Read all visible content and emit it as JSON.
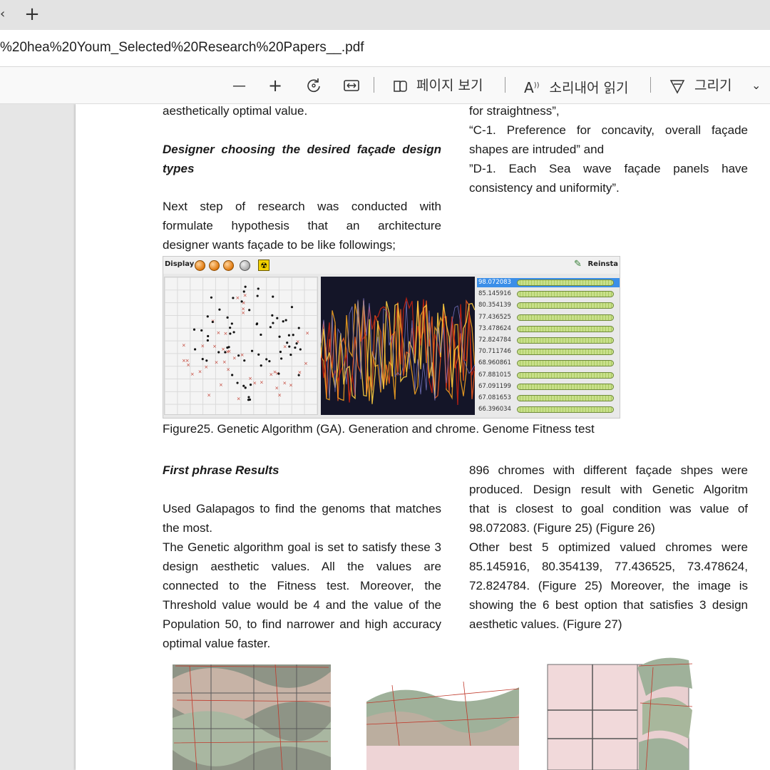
{
  "browser": {
    "close_glyph": "‹",
    "new_tab_glyph": "+",
    "url": "%20hea%20Youm_Selected%20Research%20Papers__.pdf"
  },
  "toolbar": {
    "zoom_out": "—",
    "zoom_in": "+",
    "rotate_icon": "rotate-icon",
    "fit_icon": "fit-width-icon",
    "page_view_label": "페이지 보기",
    "read_aloud_label": "소리내어 읽기",
    "draw_label": "그리기",
    "chevron": "⌄"
  },
  "page": {
    "left_col": {
      "line0": "aesthetically optimal value.",
      "heading1_line1": "Designer choosing the desired façade design",
      "heading1_line2": "types",
      "para1_lines": [
        "Next step of research was conducted with",
        "formulate hypothesis that an architecture",
        "designer wants façade to be like followings;"
      ],
      "heading2": "First phrase Results",
      "para2_lines": [
        "Used Galapagos to find the genoms that matches",
        "the most.",
        "The Genetic algorithm goal is set to satisfy these 3",
        "design aesthetic values. All the values are",
        "connected to the Fitness test. Moreover, the",
        "Threshold value would be 4 and the value of the",
        "Population 50, to find narrower and high accuracy",
        "optimal value faster."
      ]
    },
    "right_col": {
      "top_lines": [
        "for straightness”,",
        "“C-1. Preference for concavity, overall façade",
        "shapes are intruded” and",
        "”D-1. Each Sea wave façade panels have",
        "consistency and uniformity”."
      ],
      "results_lines": [
        " 896 chromes with different façade shpes were",
        "produced.  Design result with Genetic Algoritm",
        "that is closest to goal condition was value of",
        "98.072083. (Figure 25) (Figure 26)",
        "Other best 5 optimized valued chromes were",
        "85.145916, 80.354139, 77.436525, 73.478624,",
        "72.824784.  (Figure 25) Moreover, the image is",
        "showing the 6 best option that satisfies 3 design",
        "aesthetic values.  (Figure 27)"
      ]
    },
    "figure25": {
      "display_label": "Display",
      "reinsta_label": "Reinsta",
      "fitness_values": [
        "98.072083",
        "85.145916",
        "80.354139",
        "77.436525",
        "73.478624",
        "72.824784",
        "70.711746",
        "68.960861",
        "67.881015",
        "67.091199",
        "67.081653",
        "66.396034"
      ],
      "caption": "Figure25. Genetic Algorithm (GA). Generation and chrome. Genome Fitness test"
    }
  }
}
